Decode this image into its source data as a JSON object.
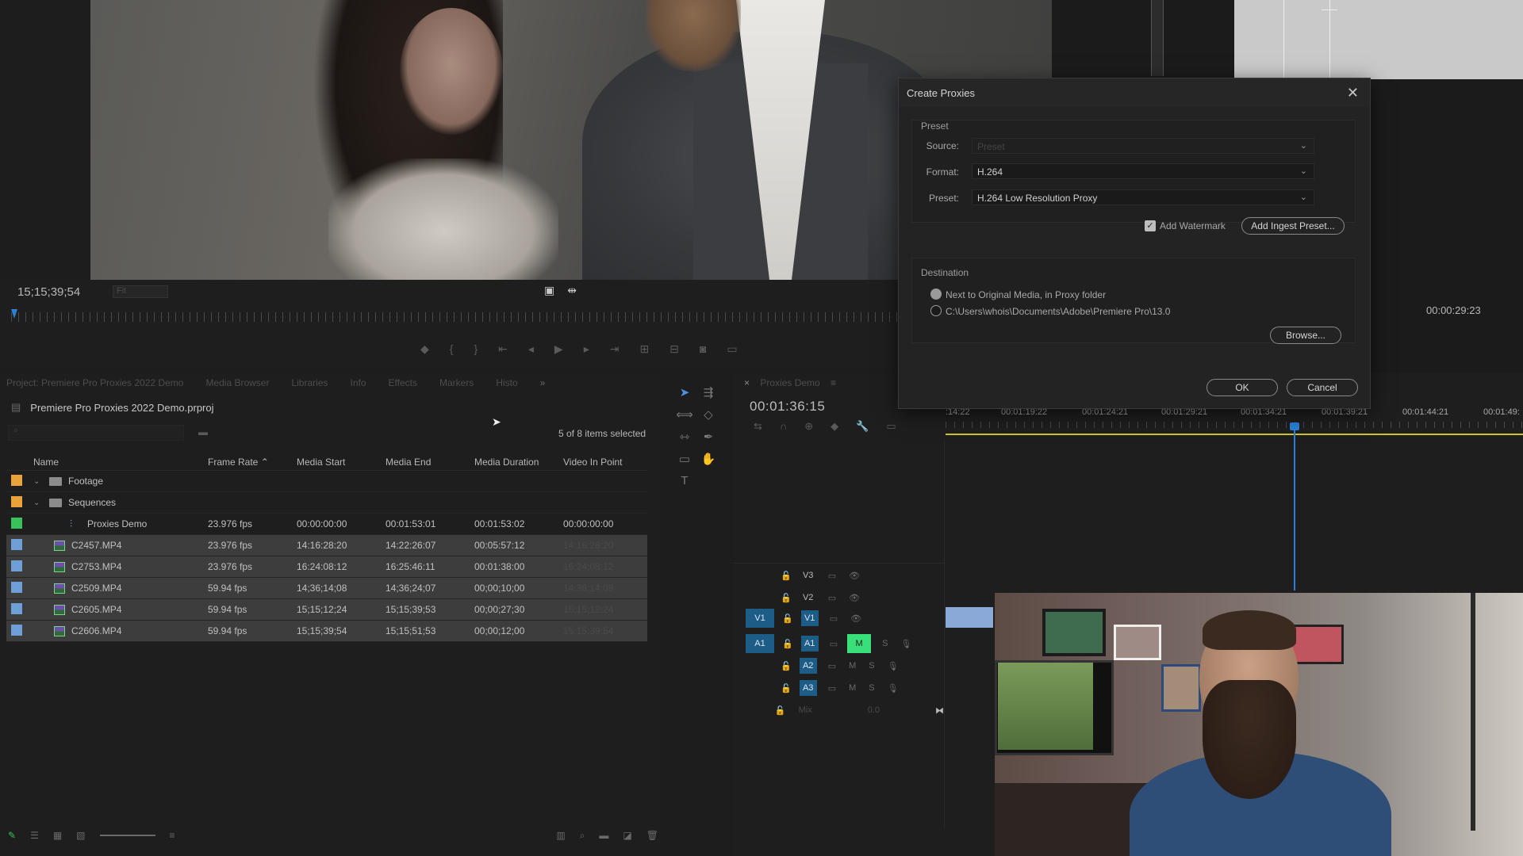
{
  "dialog": {
    "title": "Create Proxies",
    "preset_group": "Preset",
    "source_label": "Source:",
    "source_value": "Preset",
    "format_label": "Format:",
    "format_value": "H.264",
    "preset_label": "Preset:",
    "preset_value": "H.264 Low Resolution Proxy",
    "watermark_label": "Add Watermark",
    "watermark_checked": true,
    "add_ingest_preset": "Add Ingest Preset...",
    "destination_group": "Destination",
    "dest_option1": "Next to Original Media, in Proxy folder",
    "dest_option2": "C:\\Users\\whois\\Documents\\Adobe\\Premiere Pro\\13.0",
    "browse": "Browse...",
    "ok": "OK",
    "cancel": "Cancel"
  },
  "monitor": {
    "timecode_left": "15;15;39;54",
    "fit": "Fit",
    "timecode_right": "00:00:29:23"
  },
  "project": {
    "tabs": [
      "Project: Premiere Pro Proxies 2022 Demo",
      "Media Browser",
      "Libraries",
      "Info",
      "Effects",
      "Markers",
      "Histo"
    ],
    "file_name": "Premiere Pro Proxies 2022 Demo.prproj",
    "items_selected": "5 of 8 items selected",
    "columns": [
      "Name",
      "Frame Rate",
      "Media Start",
      "Media End",
      "Media Duration",
      "Video In Point"
    ],
    "rows": [
      {
        "swatch": "#e9a33a",
        "type": "folder",
        "twist": "⌄",
        "indent": 0,
        "name": "Footage",
        "fr": "",
        "ms": "",
        "me": "",
        "md": "",
        "vi": "",
        "selected": false
      },
      {
        "swatch": "#e9a33a",
        "type": "folder",
        "twist": "⌄",
        "indent": 0,
        "name": "Sequences",
        "fr": "",
        "ms": "",
        "me": "",
        "md": "",
        "vi": "",
        "selected": false
      },
      {
        "swatch": "#39c25a",
        "type": "sequence",
        "twist": "",
        "indent": 1,
        "name": "Proxies Demo",
        "fr": "23.976 fps",
        "ms": "00:00:00:00",
        "me": "00:01:53:01",
        "md": "00:01:53:02",
        "vi": "00:00:00:00",
        "selected": false
      },
      {
        "swatch": "#6e9fd6",
        "type": "clip",
        "twist": "",
        "indent": 0,
        "name": "C2457.MP4",
        "fr": "23.976 fps",
        "ms": "14:16:28:20",
        "me": "14:22:26:07",
        "md": "00:05:57:12",
        "vi": "14:16:28:20",
        "selected": true
      },
      {
        "swatch": "#6e9fd6",
        "type": "clip",
        "twist": "",
        "indent": 0,
        "name": "C2753.MP4",
        "fr": "23.976 fps",
        "ms": "16:24:08:12",
        "me": "16:25:46:11",
        "md": "00:01:38:00",
        "vi": "16:24:08:12",
        "selected": true
      },
      {
        "swatch": "#6e9fd6",
        "type": "clip",
        "twist": "",
        "indent": 0,
        "name": "C2509.MP4",
        "fr": "59.94 fps",
        "ms": "14;36;14;08",
        "me": "14;36;24;07",
        "md": "00;00;10;00",
        "vi": "14;36;14;08",
        "selected": true
      },
      {
        "swatch": "#6e9fd6",
        "type": "clip",
        "twist": "",
        "indent": 0,
        "name": "C2605.MP4",
        "fr": "59.94 fps",
        "ms": "15;15;12;24",
        "me": "15;15;39;53",
        "md": "00;00;27;30",
        "vi": "15;15;12;24",
        "selected": true
      },
      {
        "swatch": "#6e9fd6",
        "type": "clip",
        "twist": "",
        "indent": 0,
        "name": "C2606.MP4",
        "fr": "59.94 fps",
        "ms": "15;15;39;54",
        "me": "15;15;51;53",
        "md": "00;00;12;00",
        "vi": "15;15;39;54",
        "selected": true
      }
    ]
  },
  "timeline": {
    "tab": "Proxies Demo",
    "timecode": "00:01:36:15",
    "ruler": [
      ":14:22",
      "00:01:19:22",
      "00:01:24:21",
      "00:01:29:21",
      "00:01:34:21",
      "00:01:39:21",
      "00:01:44:21",
      "00:01:49:"
    ],
    "tracks": {
      "v3": "V3",
      "v2": "V2",
      "v1": "V1",
      "a1": "A1",
      "a2": "A2",
      "a3": "A3",
      "m": "M",
      "s": "S",
      "mix": "Mix",
      "mix_value": "0.0"
    }
  }
}
